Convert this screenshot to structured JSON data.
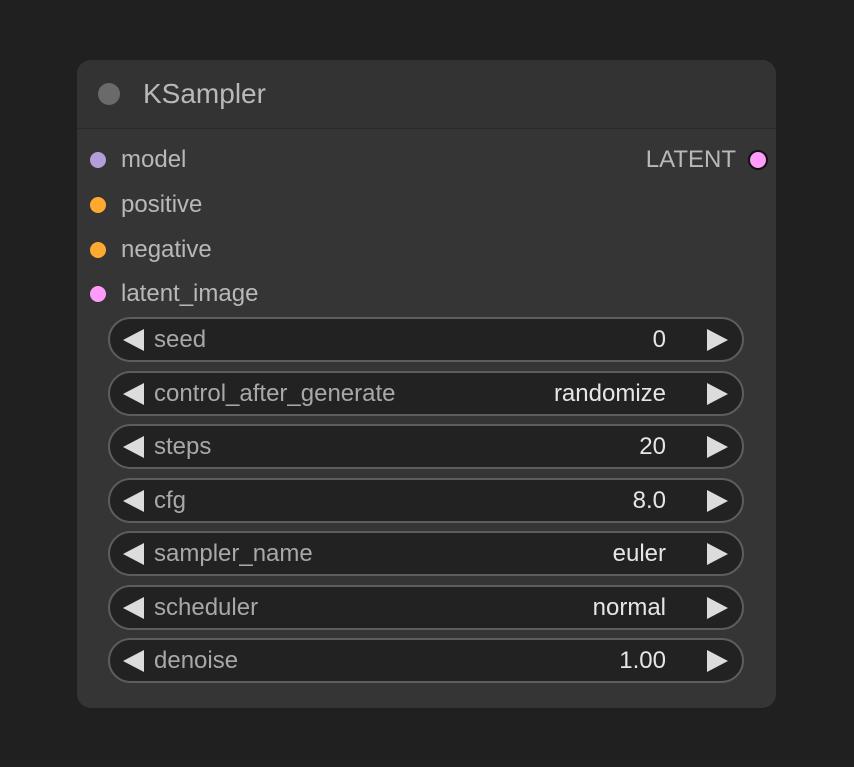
{
  "node": {
    "title": "KSampler",
    "colors": {
      "background": "#353535",
      "canvas": "#202020",
      "widget_bg": "#222222",
      "widget_border": "#5d5d5d",
      "status_dot": "#6a6a6a"
    }
  },
  "inputs": [
    {
      "label": "model",
      "color": "#b39ddb"
    },
    {
      "label": "positive",
      "color": "#ffa931"
    },
    {
      "label": "negative",
      "color": "#ffa931"
    },
    {
      "label": "latent_image",
      "color": "#ff9cf9"
    }
  ],
  "outputs": [
    {
      "label": "LATENT",
      "color": "#ff9cf9"
    }
  ],
  "widgets": [
    {
      "label": "seed",
      "value": "0"
    },
    {
      "label": "control_after_generate",
      "value": "randomize"
    },
    {
      "label": "steps",
      "value": "20"
    },
    {
      "label": "cfg",
      "value": "8.0"
    },
    {
      "label": "sampler_name",
      "value": "euler"
    },
    {
      "label": "scheduler",
      "value": "normal"
    },
    {
      "label": "denoise",
      "value": "1.00"
    }
  ],
  "icons": {
    "decrement": "left-triangle-icon",
    "increment": "right-triangle-icon"
  }
}
